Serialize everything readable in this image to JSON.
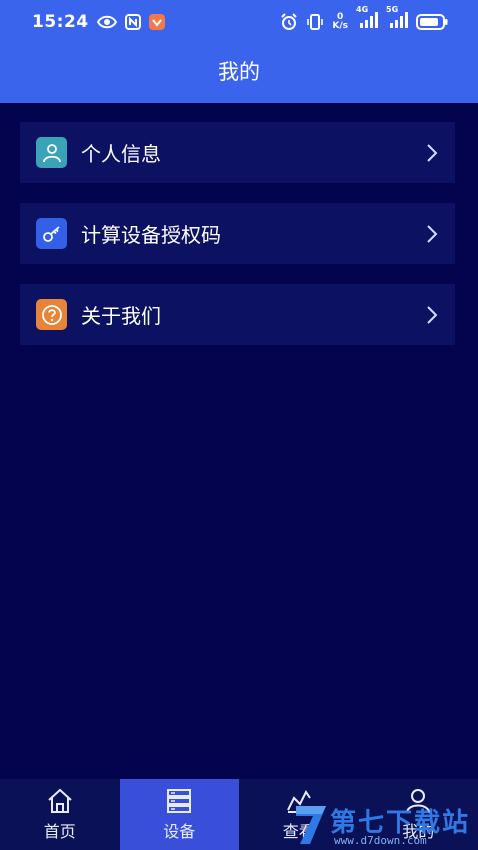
{
  "status_bar": {
    "time": "15:24",
    "net_speed_value": "0",
    "net_speed_unit": "K/s",
    "sim1_type": "4G",
    "sim2_type": "5G"
  },
  "header": {
    "title": "我的"
  },
  "menu": {
    "items": [
      {
        "label": "个人信息",
        "icon": "person-icon",
        "icon_color": "#3aa3b8"
      },
      {
        "label": "计算设备授权码",
        "icon": "key-icon",
        "icon_color": "#3360e6"
      },
      {
        "label": "关于我们",
        "icon": "question-icon",
        "icon_color": "#e8843a"
      }
    ]
  },
  "tabbar": {
    "tabs": [
      {
        "label": "首页",
        "icon": "home-icon",
        "active": false
      },
      {
        "label": "设备",
        "icon": "server-icon",
        "active": true
      },
      {
        "label": "查看",
        "icon": "chart-icon",
        "active": false
      },
      {
        "label": "我的",
        "icon": "person-icon",
        "active": false
      }
    ]
  },
  "watermark": {
    "title": "第七下载站",
    "url": "www.d7down.com"
  },
  "colors": {
    "header_bg": "#3a64ec",
    "page_bg": "#03034e",
    "card_bg": "#0c1261",
    "tab_active": "#3a4fd9"
  }
}
